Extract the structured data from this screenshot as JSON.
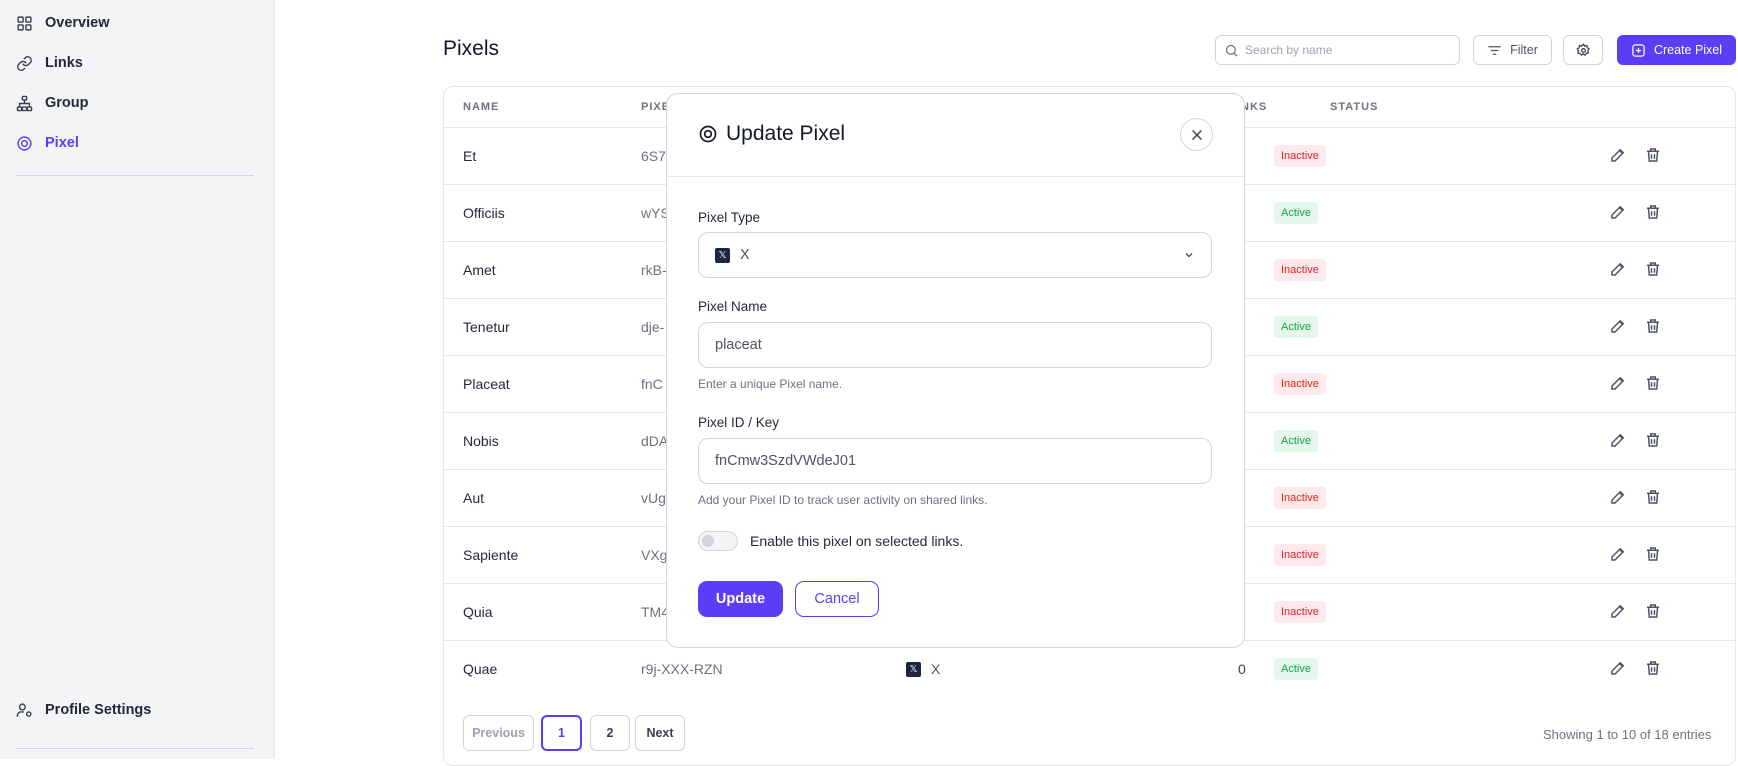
{
  "sidebar": {
    "items": [
      {
        "label": "Overview",
        "icon": "grid-icon"
      },
      {
        "label": "Links",
        "icon": "link-icon"
      },
      {
        "label": "Group",
        "icon": "hierarchy-icon"
      },
      {
        "label": "Pixel",
        "icon": "target-icon",
        "active": true
      }
    ],
    "profile_label": "Profile Settings"
  },
  "header": {
    "title": "Pixels",
    "search_placeholder": "Search by name",
    "filter_label": "Filter",
    "create_label": "Create Pixel"
  },
  "table": {
    "columns": [
      "NAME",
      "PIXE",
      "NKS",
      "STATUS"
    ],
    "rows": [
      {
        "name": "Et",
        "key": "6S7",
        "status": "Inactive"
      },
      {
        "name": "Officiis",
        "key": "wYS",
        "status": "Active"
      },
      {
        "name": "Amet",
        "key": "rkB-",
        "status": "Inactive"
      },
      {
        "name": "Tenetur",
        "key": "dje-",
        "status": "Active"
      },
      {
        "name": "Placeat",
        "key": "fnC",
        "status": "Inactive"
      },
      {
        "name": "Nobis",
        "key": "dDA",
        "status": "Active"
      },
      {
        "name": "Aut",
        "key": "vUg",
        "status": "Inactive"
      },
      {
        "name": "Sapiente",
        "key": "VXg",
        "status": "Inactive"
      },
      {
        "name": "Quia",
        "key": "TM4",
        "status": "Inactive"
      },
      {
        "name": "Quae",
        "key": "r9j-XXX-RZN",
        "type": "X",
        "links": "0",
        "status": "Active"
      }
    ]
  },
  "pagination": {
    "previous": "Previous",
    "pages": [
      "1",
      "2"
    ],
    "current": "1",
    "next": "Next",
    "showing": "Showing 1 to 10 of 18 entries"
  },
  "modal": {
    "title": "Update Pixel",
    "pixel_type_label": "Pixel Type",
    "pixel_type_value": "X",
    "pixel_name_label": "Pixel Name",
    "pixel_name_value": "placeat",
    "pixel_name_hint": "Enter a unique Pixel name.",
    "pixel_id_label": "Pixel ID / Key",
    "pixel_id_value": "fnCmw3SzdVWdeJ01",
    "pixel_id_hint": "Add your Pixel ID to track user activity on shared links.",
    "toggle_label": "Enable this pixel on selected links.",
    "toggle_on": false,
    "update_label": "Update",
    "cancel_label": "Cancel"
  },
  "colors": {
    "accent": "#5b3df5",
    "inactive": "#dc2626",
    "active": "#16a34a"
  }
}
